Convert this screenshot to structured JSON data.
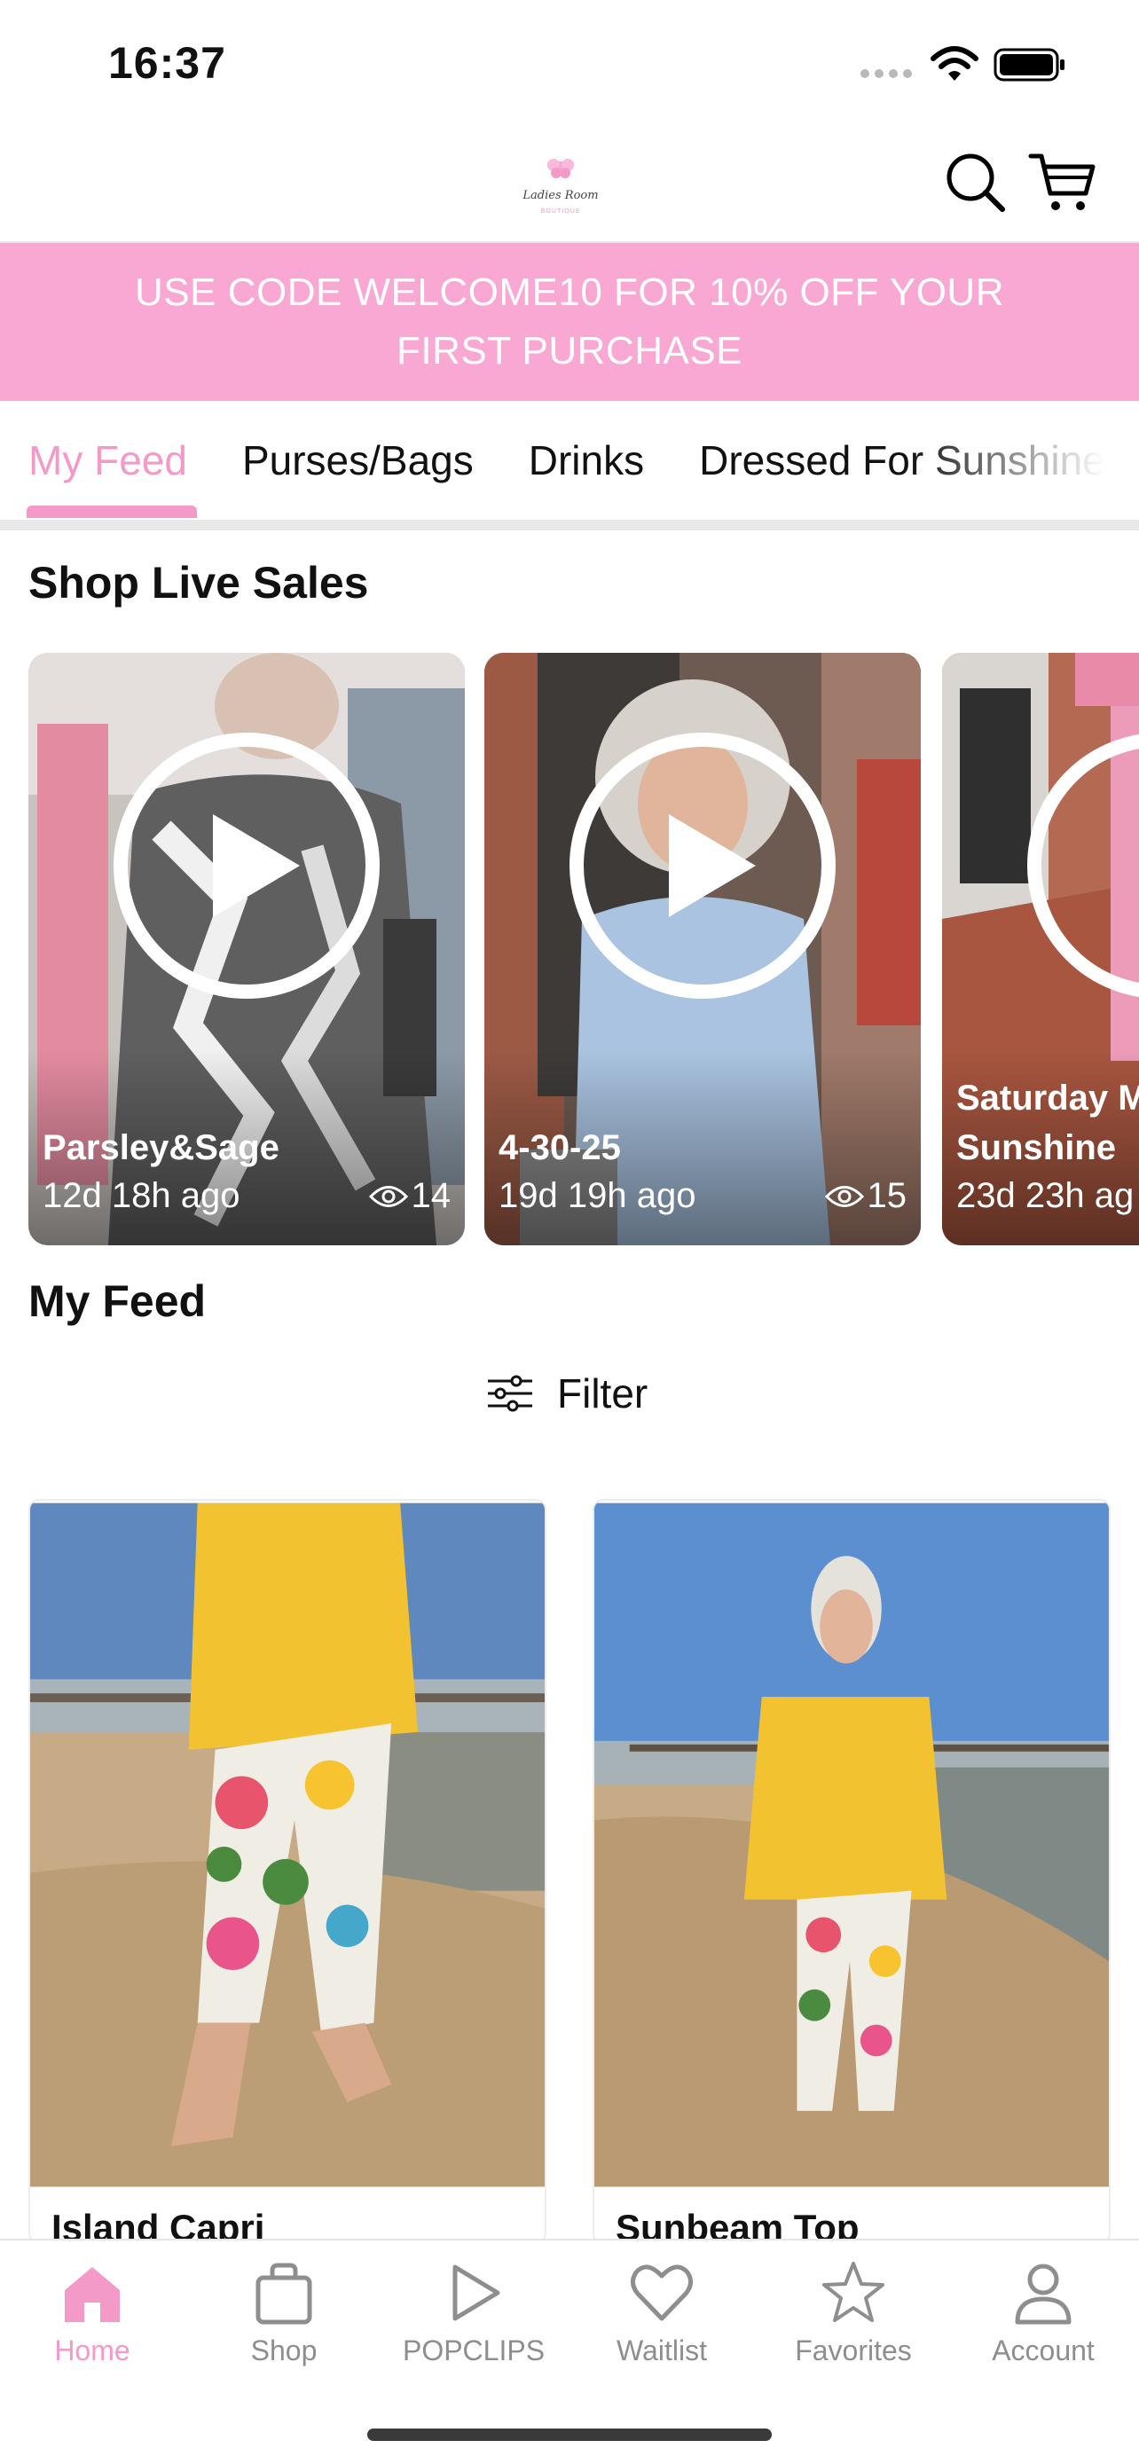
{
  "status_bar": {
    "time": "16:37"
  },
  "header": {
    "logo_text": "Ladies Room",
    "logo_subtext": "BOUTIQUE",
    "icons": {
      "search": "search-icon",
      "cart": "cart-icon"
    }
  },
  "promo": {
    "text": "USE CODE WELCOME10 FOR 10% OFF YOUR FIRST PURCHASE"
  },
  "tabs": [
    {
      "label": "My Feed",
      "active": true
    },
    {
      "label": "Purses/Bags",
      "active": false
    },
    {
      "label": "Drinks",
      "active": false
    },
    {
      "label": "Dressed For Sunshine",
      "active": false
    }
  ],
  "live_sales": {
    "title": "Shop Live Sales",
    "items": [
      {
        "title": "Parsley&Sage",
        "time": "12d 18h ago",
        "views": "14"
      },
      {
        "title": "4-30-25",
        "time": "19d 19h ago",
        "views": "15"
      },
      {
        "title": "Saturday M\nSunshine",
        "time": "23d 23h ag",
        "views": ""
      }
    ]
  },
  "feed": {
    "title": "My Feed",
    "filter_label": "Filter",
    "products": [
      {
        "name": "Island Capri"
      },
      {
        "name": "Sunbeam Top"
      }
    ]
  },
  "bottom_nav": [
    {
      "label": "Home",
      "icon": "home-icon",
      "active": true
    },
    {
      "label": "Shop",
      "icon": "bag-icon",
      "active": false
    },
    {
      "label": "POPCLIPS",
      "icon": "play-icon",
      "active": false
    },
    {
      "label": "Waitlist",
      "icon": "heart-icon",
      "active": false
    },
    {
      "label": "Favorites",
      "icon": "star-icon",
      "active": false
    },
    {
      "label": "Account",
      "icon": "person-icon",
      "active": false
    }
  ],
  "colors": {
    "accent": "#f39ac8",
    "promo_bg": "#f8a8d3"
  }
}
